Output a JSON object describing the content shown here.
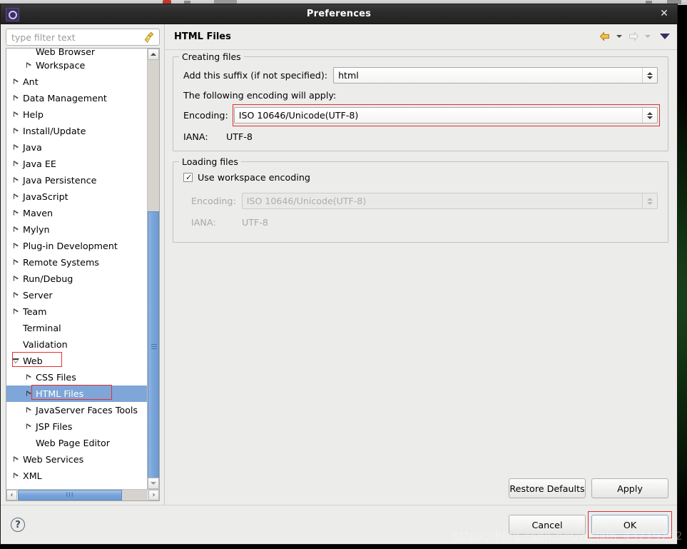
{
  "window": {
    "title": "Preferences",
    "icon": "gear-icon",
    "close_label": "✕"
  },
  "filter": {
    "placeholder": "type filter text",
    "clear_icon": "broom-icon"
  },
  "tree": {
    "items": [
      {
        "label": "Web Browser",
        "indent": 1,
        "twisty": "none",
        "selected": false,
        "clipped": true
      },
      {
        "label": "Workspace",
        "indent": 1,
        "twisty": "right",
        "selected": false
      },
      {
        "label": "Ant",
        "indent": 0,
        "twisty": "right",
        "selected": false
      },
      {
        "label": "Data Management",
        "indent": 0,
        "twisty": "right",
        "selected": false
      },
      {
        "label": "Help",
        "indent": 0,
        "twisty": "right",
        "selected": false
      },
      {
        "label": "Install/Update",
        "indent": 0,
        "twisty": "right",
        "selected": false
      },
      {
        "label": "Java",
        "indent": 0,
        "twisty": "right",
        "selected": false
      },
      {
        "label": "Java EE",
        "indent": 0,
        "twisty": "right",
        "selected": false
      },
      {
        "label": "Java Persistence",
        "indent": 0,
        "twisty": "right",
        "selected": false
      },
      {
        "label": "JavaScript",
        "indent": 0,
        "twisty": "right",
        "selected": false
      },
      {
        "label": "Maven",
        "indent": 0,
        "twisty": "right",
        "selected": false
      },
      {
        "label": "Mylyn",
        "indent": 0,
        "twisty": "right",
        "selected": false
      },
      {
        "label": "Plug-in Development",
        "indent": 0,
        "twisty": "right",
        "selected": false
      },
      {
        "label": "Remote Systems",
        "indent": 0,
        "twisty": "right",
        "selected": false
      },
      {
        "label": "Run/Debug",
        "indent": 0,
        "twisty": "right",
        "selected": false
      },
      {
        "label": "Server",
        "indent": 0,
        "twisty": "right",
        "selected": false
      },
      {
        "label": "Team",
        "indent": 0,
        "twisty": "right",
        "selected": false
      },
      {
        "label": "Terminal",
        "indent": 0,
        "twisty": "none",
        "selected": false
      },
      {
        "label": "Validation",
        "indent": 0,
        "twisty": "none",
        "selected": false
      },
      {
        "label": "Web",
        "indent": 0,
        "twisty": "down",
        "selected": false,
        "highlight": true
      },
      {
        "label": "CSS Files",
        "indent": 1,
        "twisty": "right",
        "selected": false
      },
      {
        "label": "HTML Files",
        "indent": 1,
        "twisty": "right",
        "selected": true,
        "highlight": true
      },
      {
        "label": "JavaServer Faces Tools",
        "indent": 1,
        "twisty": "right",
        "selected": false
      },
      {
        "label": "JSP Files",
        "indent": 1,
        "twisty": "right",
        "selected": false
      },
      {
        "label": "Web Page Editor",
        "indent": 1,
        "twisty": "none",
        "selected": false
      },
      {
        "label": "Web Services",
        "indent": 0,
        "twisty": "right",
        "selected": false
      },
      {
        "label": "XML",
        "indent": 0,
        "twisty": "right",
        "selected": false
      }
    ]
  },
  "page": {
    "title": "HTML Files",
    "nav": {
      "back_icon": "back-arrow-icon",
      "back_menu_icon": "chevron-down-icon",
      "forward_icon": "forward-arrow-icon",
      "forward_menu_icon": "chevron-down-icon",
      "view_menu_icon": "view-menu-triangle-icon"
    },
    "creating_files": {
      "legend": "Creating files",
      "suffix_label": "Add this suffix (if not specified):",
      "suffix_value": "html",
      "encoding_note": "The following encoding will apply:",
      "encoding_label": "Encoding:",
      "encoding_value": "ISO 10646/Unicode(UTF-8)",
      "iana_label": "IANA:",
      "iana_value": "UTF-8"
    },
    "loading_files": {
      "legend": "Loading files",
      "use_workspace_label": "Use workspace encoding",
      "use_workspace_checked": true,
      "check_glyph": "✓",
      "encoding_label": "Encoding:",
      "encoding_value": "ISO 10646/Unicode(UTF-8)",
      "iana_label": "IANA:",
      "iana_value": "UTF-8"
    }
  },
  "footer": {
    "restore_defaults": "Restore Defaults",
    "apply": "Apply",
    "cancel": "Cancel",
    "ok": "OK",
    "help_glyph": "?"
  },
  "watermark": "https://blog.csdn.net/weixin_43719752",
  "colors": {
    "selection_blue": "#7ea6d8",
    "annotation_red": "#e03131",
    "titlebar_dark": "#2b2b2b",
    "dialog_bg": "#ececeb",
    "default_button_border": "#7aa3d2"
  }
}
